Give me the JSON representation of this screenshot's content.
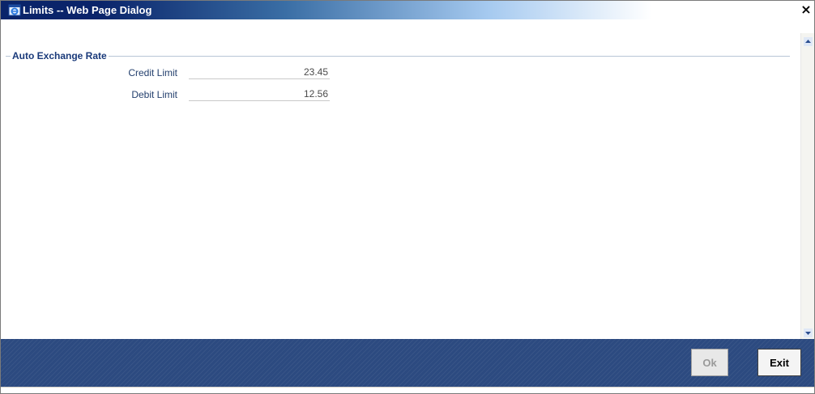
{
  "window": {
    "title": "Limits -- Web Page Dialog",
    "close_glyph": "×",
    "icon": "ie-dialog-icon"
  },
  "section": {
    "legend": "Auto Exchange Rate"
  },
  "fields": [
    {
      "label": "Credit Limit",
      "value": "23.45"
    },
    {
      "label": "Debit Limit",
      "value": "12.56"
    }
  ],
  "footer": {
    "ok_label": "Ok",
    "exit_label": "Exit"
  },
  "colors": {
    "footer_bg": "#2c4a80",
    "label_text": "#24406e",
    "title_dark": "#0a246a"
  }
}
